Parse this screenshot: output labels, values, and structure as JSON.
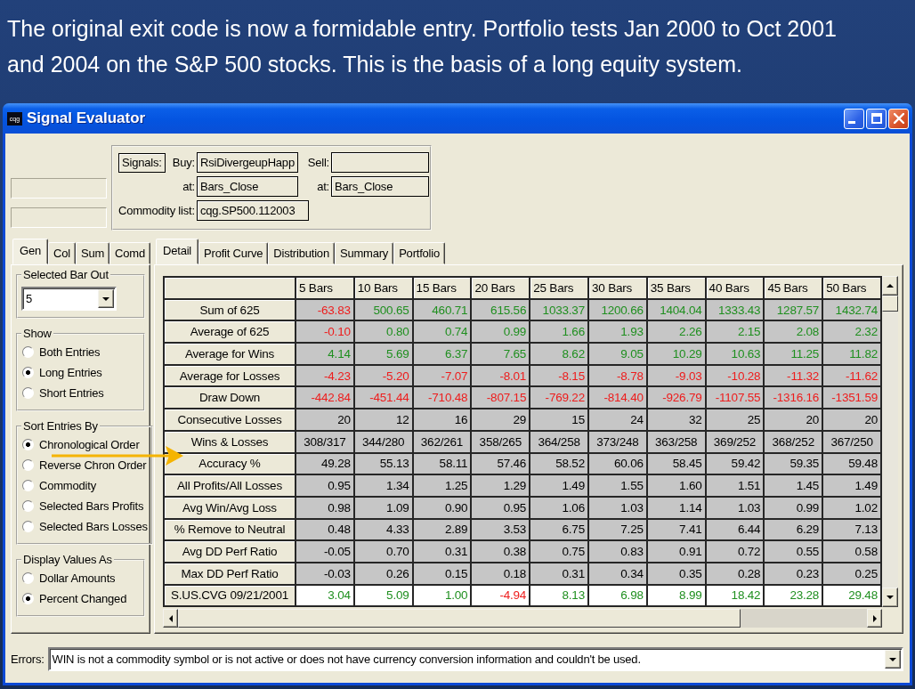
{
  "slide": {
    "heading": "The original exit code is now a formidable entry. Portfolio tests Jan 2000 to Oct 2001 and 2004 on the S&P 500 stocks. This is the basis of a long equity system."
  },
  "window": {
    "logo": "cqg",
    "title": "Signal Evaluator"
  },
  "signals": {
    "label": "Signals:",
    "rows": [
      [
        {
          "label": "Buy:",
          "value": "RsiDivergeupHapp"
        },
        {
          "label": "Sell:"
        }
      ],
      [
        {
          "label": "at:",
          "value": "Bars_Close"
        },
        {
          "label": "at:",
          "value": "Bars_Close"
        }
      ]
    ],
    "commodity_list": {
      "label": "Commodity list:",
      "value": "cqg.SP500.112003"
    }
  },
  "left_tabs": [
    {
      "label": "Gen",
      "selected": true
    },
    {
      "label": "Col",
      "selected": false
    },
    {
      "label": "Sum",
      "selected": false
    },
    {
      "label": "Comd",
      "selected": false
    }
  ],
  "left_panel": {
    "selected_bar_out": {
      "title": "Selected Bar Out",
      "value": "5"
    },
    "groups": [
      {
        "title": "Show",
        "options": [
          {
            "label": "Both Entries",
            "selected": false
          },
          {
            "label": "Long Entries",
            "selected": true
          },
          {
            "label": "Short Entries",
            "selected": false
          }
        ]
      },
      {
        "title": "Sort Entries By",
        "options": [
          {
            "label": "Chronological Order",
            "selected": true
          },
          {
            "label": "Reverse Chron Order",
            "selected": false
          },
          {
            "label": "Commodity",
            "selected": false
          },
          {
            "label": "Selected Bars Profits",
            "selected": false
          },
          {
            "label": "Selected Bars Losses",
            "selected": false
          }
        ]
      },
      {
        "title": "Display Values As",
        "options": [
          {
            "label": "Dollar Amounts",
            "selected": false
          },
          {
            "label": "Percent Changed",
            "selected": true
          }
        ]
      }
    ]
  },
  "tabs": [
    {
      "label": "Detail",
      "selected": true
    },
    {
      "label": "Profit Curve",
      "selected": false
    },
    {
      "label": "Distribution",
      "selected": false
    },
    {
      "label": "Summary",
      "selected": false
    },
    {
      "label": "Portfolio",
      "selected": false
    }
  ],
  "table": {
    "columns": [
      "5 Bars",
      "10 Bars",
      "15 Bars",
      "20 Bars",
      "25 Bars",
      "30 Bars",
      "35 Bars",
      "40 Bars",
      "45 Bars",
      "50 Bars"
    ],
    "rows": [
      {
        "label": "Sum of 625",
        "kind": "statistic",
        "cells": [
          {
            "text": "-63.83",
            "color": "#ee1c1c"
          },
          {
            "text": "500.65",
            "color": "#1f8f1f"
          },
          {
            "text": "460.71",
            "color": "#1f8f1f"
          },
          {
            "text": "615.56",
            "color": "#1f8f1f"
          },
          {
            "text": "1033.37",
            "color": "#1f8f1f"
          },
          {
            "text": "1200.66",
            "color": "#1f8f1f"
          },
          {
            "text": "1404.04",
            "color": "#1f8f1f"
          },
          {
            "text": "1333.43",
            "color": "#1f8f1f"
          },
          {
            "text": "1287.57",
            "color": "#1f8f1f"
          },
          {
            "text": "1432.74",
            "color": "#1f8f1f"
          }
        ]
      },
      {
        "label": "Average of 625",
        "kind": "statistic",
        "cells": [
          {
            "text": "-0.10",
            "color": "#ee1c1c"
          },
          {
            "text": "0.80",
            "color": "#1f8f1f"
          },
          {
            "text": "0.74",
            "color": "#1f8f1f"
          },
          {
            "text": "0.99",
            "color": "#1f8f1f"
          },
          {
            "text": "1.66",
            "color": "#1f8f1f"
          },
          {
            "text": "1.93",
            "color": "#1f8f1f"
          },
          {
            "text": "2.26",
            "color": "#1f8f1f"
          },
          {
            "text": "2.15",
            "color": "#1f8f1f"
          },
          {
            "text": "2.08",
            "color": "#1f8f1f"
          },
          {
            "text": "2.32",
            "color": "#1f8f1f"
          }
        ]
      },
      {
        "label": "Average for Wins",
        "kind": "statistic",
        "cells": [
          {
            "text": "4.14",
            "color": "#1f8f1f"
          },
          {
            "text": "5.69",
            "color": "#1f8f1f"
          },
          {
            "text": "6.37",
            "color": "#1f8f1f"
          },
          {
            "text": "7.65",
            "color": "#1f8f1f"
          },
          {
            "text": "8.62",
            "color": "#1f8f1f"
          },
          {
            "text": "9.05",
            "color": "#1f8f1f"
          },
          {
            "text": "10.29",
            "color": "#1f8f1f"
          },
          {
            "text": "10.63",
            "color": "#1f8f1f"
          },
          {
            "text": "11.25",
            "color": "#1f8f1f"
          },
          {
            "text": "11.82",
            "color": "#1f8f1f"
          }
        ]
      },
      {
        "label": "Average for Losses",
        "kind": "statistic",
        "cells": [
          {
            "text": "-4.23",
            "color": "#ee1c1c"
          },
          {
            "text": "-5.20",
            "color": "#ee1c1c"
          },
          {
            "text": "-7.07",
            "color": "#ee1c1c"
          },
          {
            "text": "-8.01",
            "color": "#ee1c1c"
          },
          {
            "text": "-8.15",
            "color": "#ee1c1c"
          },
          {
            "text": "-8.78",
            "color": "#ee1c1c"
          },
          {
            "text": "-9.03",
            "color": "#ee1c1c"
          },
          {
            "text": "-10.28",
            "color": "#ee1c1c"
          },
          {
            "text": "-11.32",
            "color": "#ee1c1c"
          },
          {
            "text": "-11.62",
            "color": "#ee1c1c"
          }
        ]
      },
      {
        "label": "Draw Down",
        "kind": "statistic",
        "cells": [
          {
            "text": "-442.84",
            "color": "#ee1c1c"
          },
          {
            "text": "-451.44",
            "color": "#ee1c1c"
          },
          {
            "text": "-710.48",
            "color": "#ee1c1c"
          },
          {
            "text": "-807.15",
            "color": "#ee1c1c"
          },
          {
            "text": "-769.22",
            "color": "#ee1c1c"
          },
          {
            "text": "-814.40",
            "color": "#ee1c1c"
          },
          {
            "text": "-926.79",
            "color": "#ee1c1c"
          },
          {
            "text": "-1107.55",
            "color": "#ee1c1c"
          },
          {
            "text": "-1316.16",
            "color": "#ee1c1c"
          },
          {
            "text": "-1351.59",
            "color": "#ee1c1c"
          }
        ]
      },
      {
        "label": "Consecutive Losses",
        "kind": "statistic",
        "cells": [
          {
            "text": "20",
            "color": "#000000"
          },
          {
            "text": "12",
            "color": "#000000"
          },
          {
            "text": "16",
            "color": "#000000"
          },
          {
            "text": "29",
            "color": "#000000"
          },
          {
            "text": "15",
            "color": "#000000"
          },
          {
            "text": "24",
            "color": "#000000"
          },
          {
            "text": "32",
            "color": "#000000"
          },
          {
            "text": "25",
            "color": "#000000"
          },
          {
            "text": "20",
            "color": "#000000"
          },
          {
            "text": "20",
            "color": "#000000"
          }
        ]
      },
      {
        "label": "Wins & Losses",
        "kind": "ratio",
        "cells": [
          {
            "text": "308/317",
            "color": "#000000"
          },
          {
            "text": "344/280",
            "color": "#000000"
          },
          {
            "text": "362/261",
            "color": "#000000"
          },
          {
            "text": "358/265",
            "color": "#000000"
          },
          {
            "text": "364/258",
            "color": "#000000"
          },
          {
            "text": "373/248",
            "color": "#000000"
          },
          {
            "text": "363/258",
            "color": "#000000"
          },
          {
            "text": "369/252",
            "color": "#000000"
          },
          {
            "text": "368/252",
            "color": "#000000"
          },
          {
            "text": "367/250",
            "color": "#000000"
          }
        ]
      },
      {
        "label": "Accuracy %",
        "kind": "statistic",
        "cells": [
          {
            "text": "49.28",
            "color": "#000000"
          },
          {
            "text": "55.13",
            "color": "#000000"
          },
          {
            "text": "58.11",
            "color": "#000000"
          },
          {
            "text": "57.46",
            "color": "#000000"
          },
          {
            "text": "58.52",
            "color": "#000000"
          },
          {
            "text": "60.06",
            "color": "#000000"
          },
          {
            "text": "58.45",
            "color": "#000000"
          },
          {
            "text": "59.42",
            "color": "#000000"
          },
          {
            "text": "59.35",
            "color": "#000000"
          },
          {
            "text": "59.48",
            "color": "#000000"
          }
        ]
      },
      {
        "label": "All Profits/All Losses",
        "kind": "statistic",
        "cells": [
          {
            "text": "0.95",
            "color": "#000000"
          },
          {
            "text": "1.34",
            "color": "#000000"
          },
          {
            "text": "1.25",
            "color": "#000000"
          },
          {
            "text": "1.29",
            "color": "#000000"
          },
          {
            "text": "1.49",
            "color": "#000000"
          },
          {
            "text": "1.55",
            "color": "#000000"
          },
          {
            "text": "1.60",
            "color": "#000000"
          },
          {
            "text": "1.51",
            "color": "#000000"
          },
          {
            "text": "1.45",
            "color": "#000000"
          },
          {
            "text": "1.49",
            "color": "#000000"
          }
        ]
      },
      {
        "label": "Avg Win/Avg Loss",
        "kind": "statistic",
        "cells": [
          {
            "text": "0.98",
            "color": "#000000"
          },
          {
            "text": "1.09",
            "color": "#000000"
          },
          {
            "text": "0.90",
            "color": "#000000"
          },
          {
            "text": "0.95",
            "color": "#000000"
          },
          {
            "text": "1.06",
            "color": "#000000"
          },
          {
            "text": "1.03",
            "color": "#000000"
          },
          {
            "text": "1.14",
            "color": "#000000"
          },
          {
            "text": "1.03",
            "color": "#000000"
          },
          {
            "text": "0.99",
            "color": "#000000"
          },
          {
            "text": "1.02",
            "color": "#000000"
          }
        ]
      },
      {
        "label": "% Remove to Neutral",
        "kind": "statistic",
        "cells": [
          {
            "text": "0.48",
            "color": "#000000"
          },
          {
            "text": "4.33",
            "color": "#000000"
          },
          {
            "text": "2.89",
            "color": "#000000"
          },
          {
            "text": "3.53",
            "color": "#000000"
          },
          {
            "text": "6.75",
            "color": "#000000"
          },
          {
            "text": "7.25",
            "color": "#000000"
          },
          {
            "text": "7.41",
            "color": "#000000"
          },
          {
            "text": "6.44",
            "color": "#000000"
          },
          {
            "text": "6.29",
            "color": "#000000"
          },
          {
            "text": "7.13",
            "color": "#000000"
          }
        ]
      },
      {
        "label": "Avg DD Perf Ratio",
        "kind": "statistic",
        "cells": [
          {
            "text": "-0.05",
            "color": "#000000"
          },
          {
            "text": "0.70",
            "color": "#000000"
          },
          {
            "text": "0.31",
            "color": "#000000"
          },
          {
            "text": "0.38",
            "color": "#000000"
          },
          {
            "text": "0.75",
            "color": "#000000"
          },
          {
            "text": "0.83",
            "color": "#000000"
          },
          {
            "text": "0.91",
            "color": "#000000"
          },
          {
            "text": "0.72",
            "color": "#000000"
          },
          {
            "text": "0.55",
            "color": "#000000"
          },
          {
            "text": "0.58",
            "color": "#000000"
          }
        ]
      },
      {
        "label": "Max DD Perf Ratio",
        "kind": "statistic",
        "cells": [
          {
            "text": "-0.03",
            "color": "#000000"
          },
          {
            "text": "0.26",
            "color": "#000000"
          },
          {
            "text": "0.15",
            "color": "#000000"
          },
          {
            "text": "0.18",
            "color": "#000000"
          },
          {
            "text": "0.31",
            "color": "#000000"
          },
          {
            "text": "0.34",
            "color": "#000000"
          },
          {
            "text": "0.35",
            "color": "#000000"
          },
          {
            "text": "0.28",
            "color": "#000000"
          },
          {
            "text": "0.23",
            "color": "#000000"
          },
          {
            "text": "0.25",
            "color": "#000000"
          }
        ]
      },
      {
        "label": "S.US.CVG 09/21/2001",
        "kind": "trade",
        "cells": [
          {
            "text": "3.04",
            "color": "#1f8f1f"
          },
          {
            "text": "5.09",
            "color": "#1f8f1f"
          },
          {
            "text": "1.00",
            "color": "#1f8f1f"
          },
          {
            "text": "-4.94",
            "color": "#ee1c1c"
          },
          {
            "text": "8.13",
            "color": "#1f8f1f"
          },
          {
            "text": "6.98",
            "color": "#1f8f1f"
          },
          {
            "text": "8.99",
            "color": "#1f8f1f"
          },
          {
            "text": "18.42",
            "color": "#1f8f1f"
          },
          {
            "text": "23.28",
            "color": "#1f8f1f"
          },
          {
            "text": "29.48",
            "color": "#1f8f1f"
          }
        ]
      }
    ]
  },
  "errors": {
    "label": "Errors:",
    "value": "WIN is not a commodity symbol or is not active or does not have currency conversion information and couldn't be used."
  }
}
